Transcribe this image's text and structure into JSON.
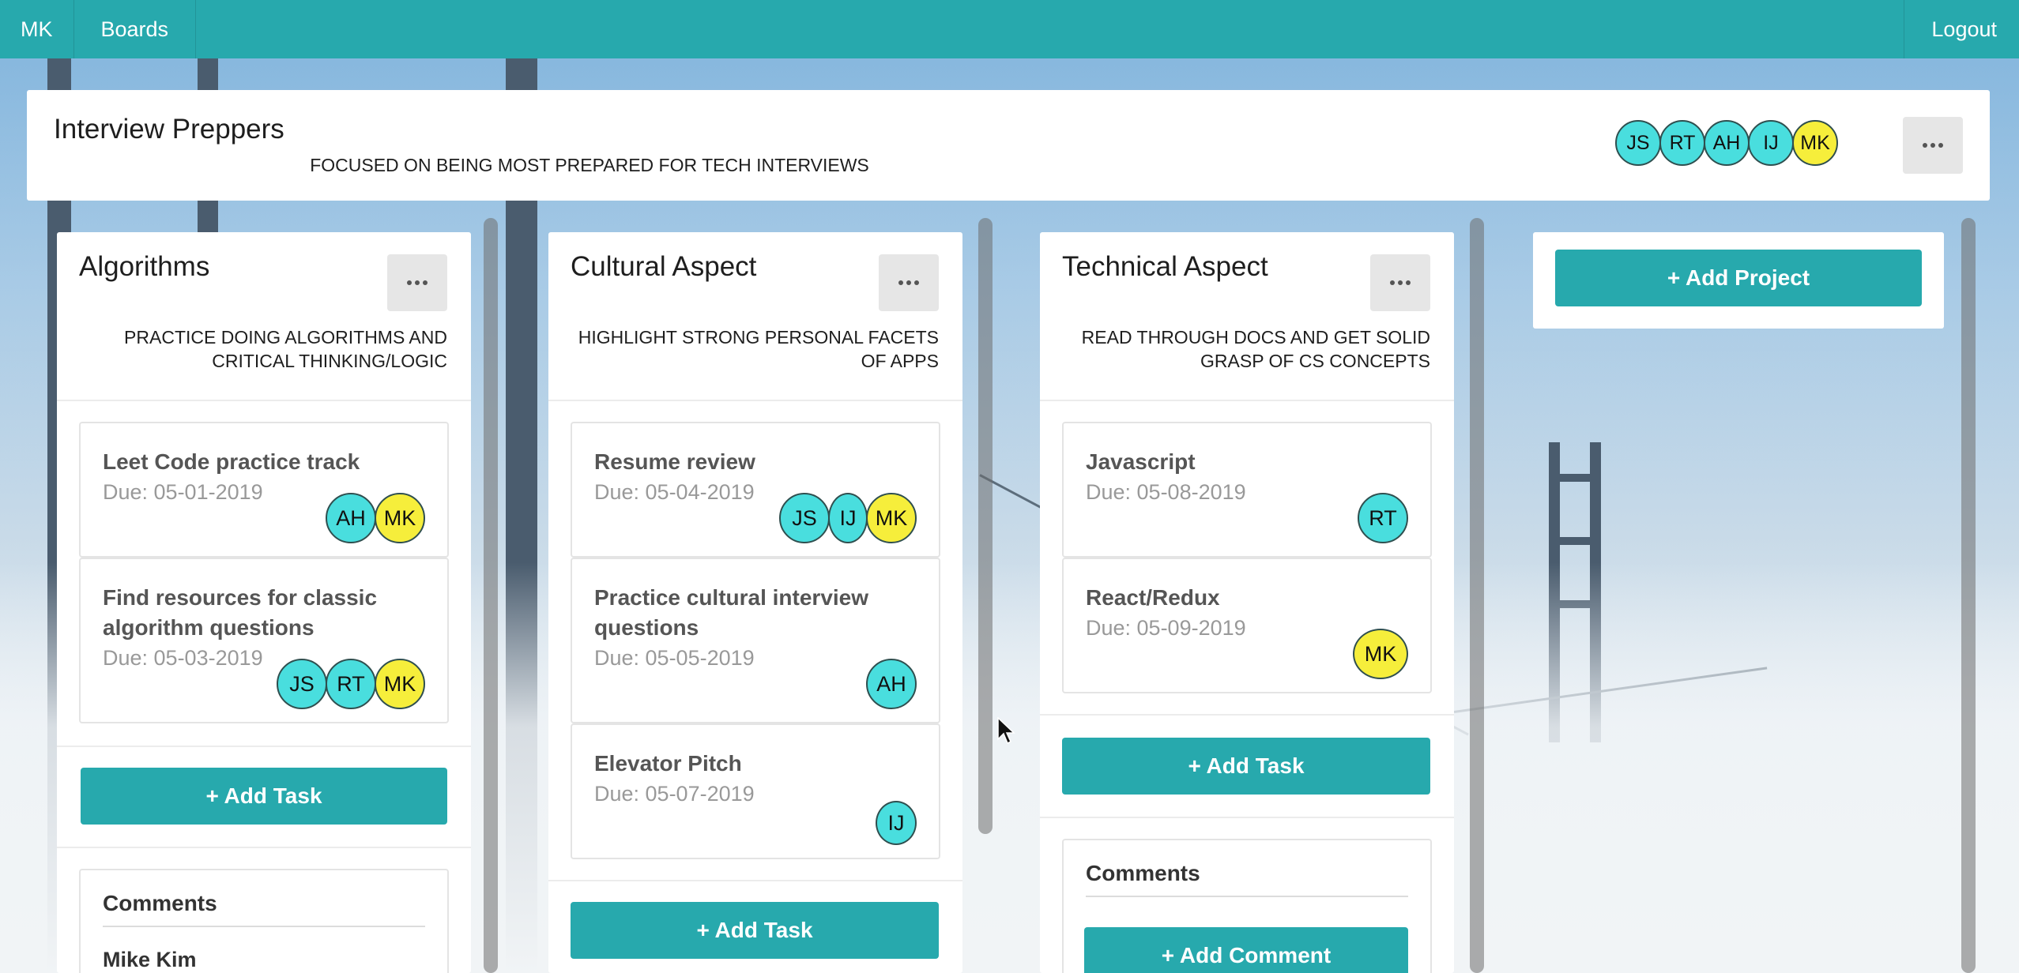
{
  "navbar": {
    "user_initials": "MK",
    "boards_label": "Boards",
    "logout_label": "Logout"
  },
  "board": {
    "title": "Interview Preppers",
    "description": "FOCUSED ON BEING MOST PREPARED FOR TECH INTERVIEWS",
    "members": [
      "JS",
      "RT",
      "AH",
      "IJ",
      "MK"
    ]
  },
  "columns": [
    {
      "title": "Algorithms",
      "description": "PRACTICE DOING ALGORITHMS AND CRITICAL THINKING/LOGIC",
      "tasks": [
        {
          "name": "Leet Code practice track",
          "due": "Due: 05-01-2019",
          "assignees": [
            "AH",
            "MK"
          ]
        },
        {
          "name": "Find resources for classic algorithm questions",
          "due": "Due: 05-03-2019",
          "assignees": [
            "JS",
            "RT",
            "MK"
          ]
        }
      ],
      "add_task_label": "+ Add Task",
      "comments_title": "Comments",
      "comment_author": "Mike Kim"
    },
    {
      "title": "Cultural Aspect",
      "description": "HIGHLIGHT STRONG PERSONAL FACETS OF APPS",
      "tasks": [
        {
          "name": "Resume review",
          "due": "Due: 05-04-2019",
          "assignees": [
            "JS",
            "IJ",
            "MK"
          ]
        },
        {
          "name": "Practice cultural interview questions",
          "due": "Due: 05-05-2019",
          "assignees": [
            "AH"
          ]
        },
        {
          "name": "Elevator Pitch",
          "due": "Due: 05-07-2019",
          "assignees": [
            "IJ"
          ]
        }
      ],
      "add_task_label": "+ Add Task"
    },
    {
      "title": "Technical Aspect",
      "description": "READ THROUGH DOCS AND GET SOLID GRASP OF CS CONCEPTS",
      "tasks": [
        {
          "name": "Javascript",
          "due": "Due: 05-08-2019",
          "assignees": [
            "RT"
          ]
        },
        {
          "name": "React/Redux",
          "due": "Due: 05-09-2019",
          "assignees": [
            "MK"
          ]
        }
      ],
      "add_task_label": "+ Add Task",
      "comments_title": "Comments",
      "add_comment_label": "+ Add Comment"
    }
  ],
  "add_project_label": "+ Add Project",
  "current_user": "MK",
  "colors": {
    "accent": "#27a9ad",
    "avatar_member": "#49dede",
    "avatar_current_user": "#f6ee3b"
  }
}
